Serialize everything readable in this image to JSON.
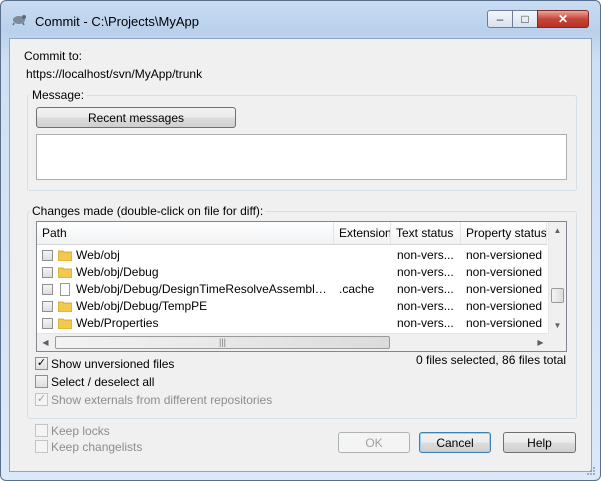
{
  "window": {
    "title": "Commit - C:\\Projects\\MyApp",
    "icon": "tortoise-svn-icon",
    "controls": {
      "minimize": "–",
      "maximize": "□",
      "close": "✕"
    }
  },
  "commit_to": {
    "label": "Commit to:",
    "url": "https://localhost/svn/MyApp/trunk"
  },
  "message": {
    "group_label": "Message:",
    "recent_button": "Recent messages",
    "text": ""
  },
  "changes": {
    "group_label": "Changes made (double-click on file for diff):",
    "columns": [
      "Path",
      "Extension",
      "Text status",
      "Property status"
    ],
    "rows": [
      {
        "icon": "folder-icon",
        "path": "Web/obj",
        "extension": "",
        "text_status": "non-vers...",
        "property_status": "non-versioned"
      },
      {
        "icon": "folder-icon",
        "path": "Web/obj/Debug",
        "extension": "",
        "text_status": "non-vers...",
        "property_status": "non-versioned"
      },
      {
        "icon": "file-icon",
        "path": "Web/obj/Debug/DesignTimeResolveAssemblyRef...",
        "extension": ".cache",
        "text_status": "non-vers...",
        "property_status": "non-versioned"
      },
      {
        "icon": "folder-icon",
        "path": "Web/obj/Debug/TempPE",
        "extension": "",
        "text_status": "non-vers...",
        "property_status": "non-versioned"
      },
      {
        "icon": "folder-icon",
        "path": "Web/Properties",
        "extension": "",
        "text_status": "non-vers...",
        "property_status": "non-versioned"
      }
    ],
    "selection_summary": "0 files selected, 86 files total"
  },
  "options": {
    "show_unversioned": {
      "label": "Show unversioned files",
      "checked": true
    },
    "select_all": {
      "label": "Select / deselect all",
      "checked": false
    },
    "show_externals": {
      "label": "Show externals from different repositories",
      "checked": true,
      "disabled": true
    },
    "keep_locks": {
      "label": "Keep locks",
      "checked": false,
      "disabled": true
    },
    "keep_changelists": {
      "label": "Keep changelists",
      "checked": false,
      "disabled": true
    }
  },
  "buttons": {
    "ok": "OK",
    "cancel": "Cancel",
    "help": "Help"
  },
  "colors": {
    "folder": "#f2c94c",
    "titlebar": "#c9dcf2",
    "watermark": "#44c767"
  }
}
